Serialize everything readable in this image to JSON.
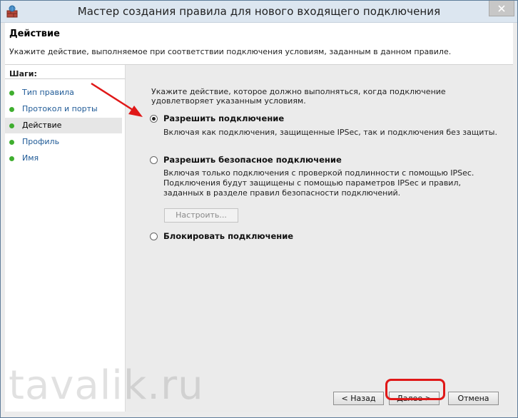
{
  "window": {
    "title": "Мастер создания правила для нового входящего подключения",
    "close_glyph": "✕"
  },
  "header": {
    "title": "Действие",
    "description": "Укажите действие, выполняемое при соответствии подключения условиям, заданным в данном правиле."
  },
  "steps": {
    "heading": "Шаги:",
    "items": [
      {
        "label": "Тип правила"
      },
      {
        "label": "Протокол и порты"
      },
      {
        "label": "Действие",
        "current": true
      },
      {
        "label": "Профиль"
      },
      {
        "label": "Имя"
      }
    ]
  },
  "main": {
    "instruction": "Укажите действие, которое должно выполняться, когда подключение удовлетворяет указанным условиям.",
    "options": [
      {
        "label": "Разрешить подключение",
        "description": "Включая как подключения, защищенные IPSec, так и подключения без защиты.",
        "checked": true
      },
      {
        "label": "Разрешить безопасное подключение",
        "description": "Включая только подключения с проверкой подлинности с помощью IPSec. Подключения будут защищены с помощью параметров IPSec и правил, заданных в разделе правил безопасности подключений.",
        "checked": false
      },
      {
        "label": "Блокировать подключение",
        "checked": false
      }
    ],
    "customize_button": "Настроить..."
  },
  "footer": {
    "back_button": "< Назад",
    "next_button": "Далее >",
    "cancel_button": "Отмена"
  },
  "watermark": "tavalik.ru",
  "colors": {
    "accent_step": "#1f5a96",
    "step_dot": "#3fae2f",
    "annotation": "#e01818"
  }
}
